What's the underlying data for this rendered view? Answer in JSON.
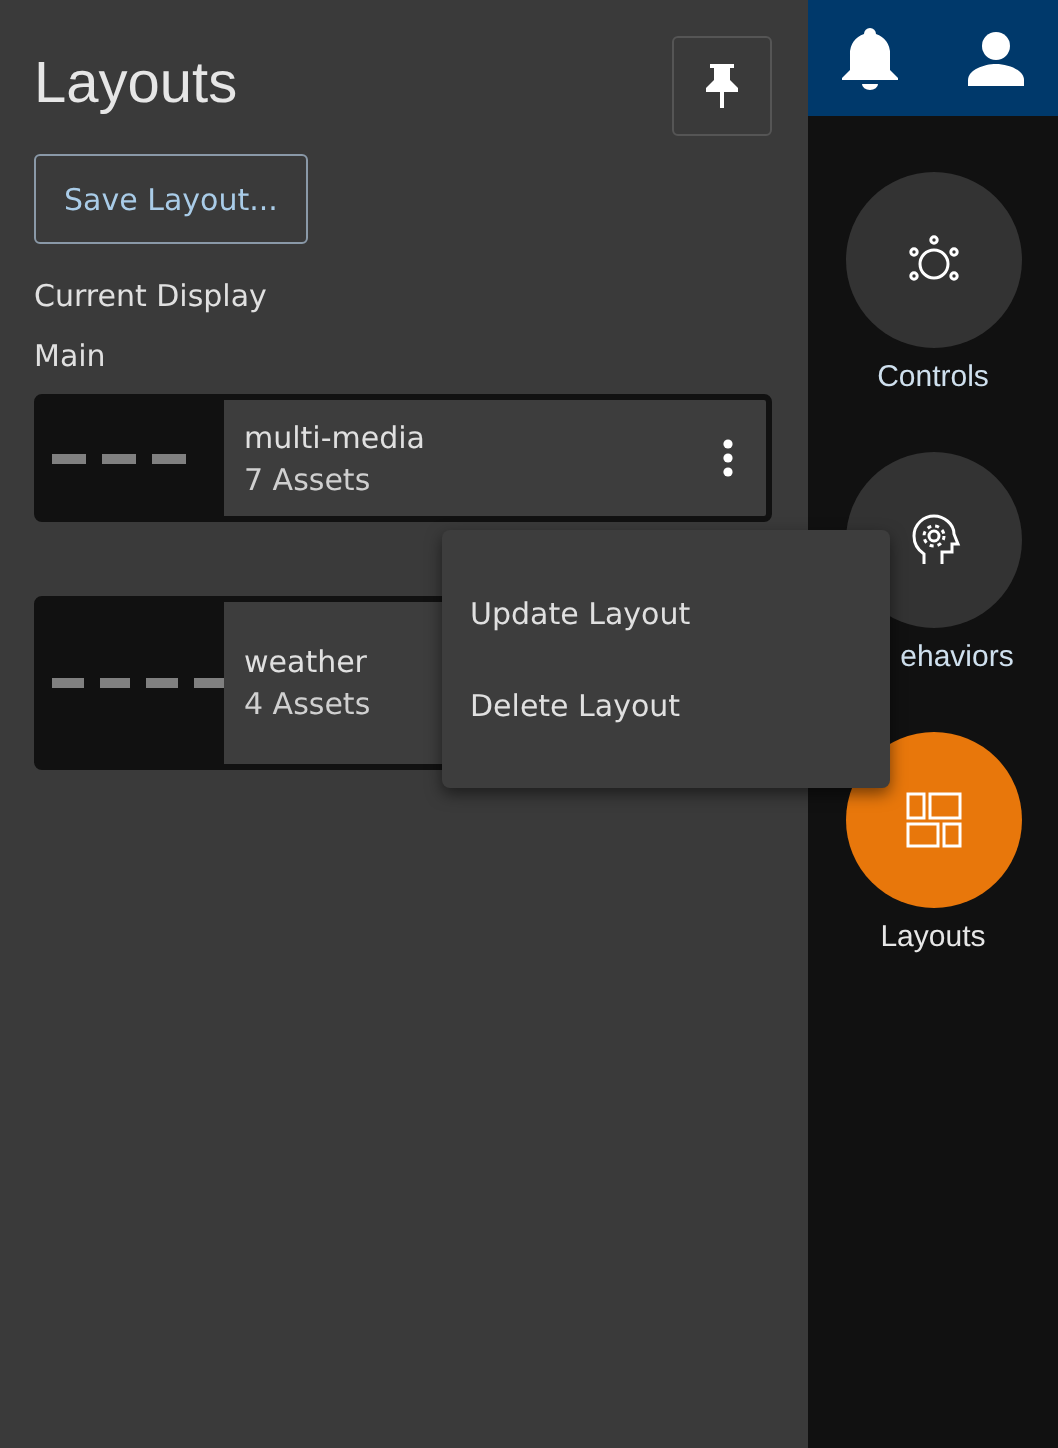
{
  "panel": {
    "title": "Layouts",
    "save_button": "Save Layout...",
    "section_label": "Current Display",
    "display_name": "Main"
  },
  "layouts": [
    {
      "name": "multi-media",
      "assets": "7 Assets",
      "menu_open": true
    },
    {
      "name": "weather",
      "assets": "4 Assets",
      "menu_open": false
    }
  ],
  "menu": [
    "Update Layout",
    "Delete Layout"
  ],
  "nav": [
    {
      "kind": "controls",
      "label": "Controls",
      "selected": false
    },
    {
      "kind": "behaviors",
      "label": "ehaviors",
      "selected": false
    },
    {
      "kind": "layouts",
      "label": "Layouts",
      "selected": true
    }
  ]
}
